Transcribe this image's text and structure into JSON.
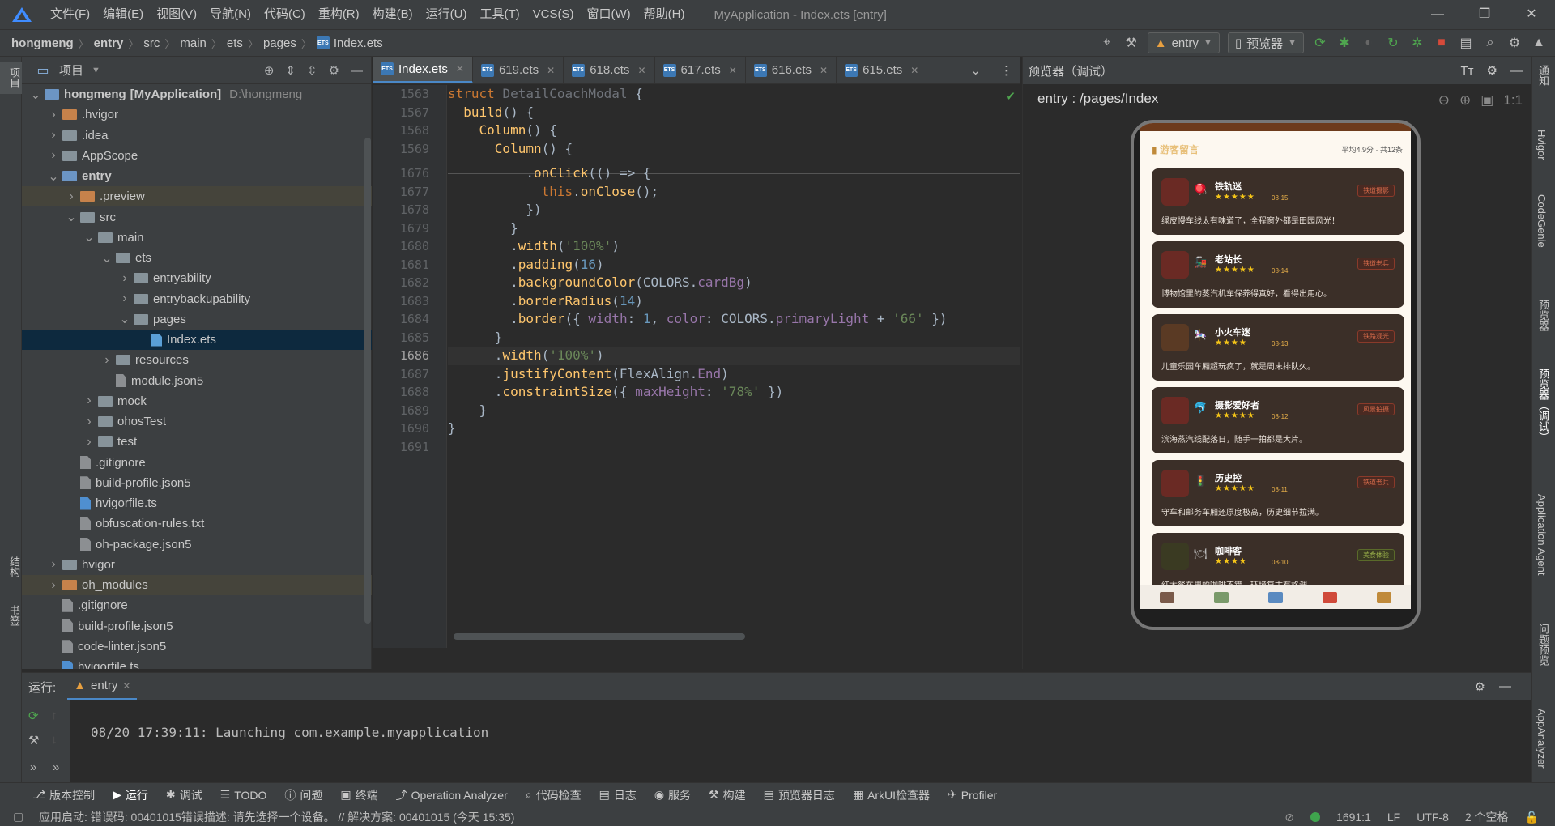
{
  "app": {
    "title": "MyApplication - Index.ets [entry]",
    "menu": [
      "文件(F)",
      "编辑(E)",
      "视图(V)",
      "导航(N)",
      "代码(C)",
      "重构(R)",
      "构建(B)",
      "运行(U)",
      "工具(T)",
      "VCS(S)",
      "窗口(W)",
      "帮助(H)"
    ]
  },
  "breadcrumb": [
    "hongmeng",
    "entry",
    "src",
    "main",
    "ets",
    "pages",
    "Index.ets"
  ],
  "toolbar": {
    "run_config": "entry",
    "device": "预览器"
  },
  "left_strip": {
    "project": "项目",
    "structure": "结构",
    "bookmarks": "书签"
  },
  "project_panel": {
    "title": "项目",
    "tree": [
      {
        "label": "hongmeng",
        "extra": "[MyApplication]",
        "path": "D:\\hongmeng",
        "depth": 0,
        "type": "module",
        "open": true
      },
      {
        "label": ".hvigor",
        "depth": 1,
        "type": "folder-orange",
        "open": false
      },
      {
        "label": ".idea",
        "depth": 1,
        "type": "folder",
        "open": false
      },
      {
        "label": "AppScope",
        "depth": 1,
        "type": "folder",
        "open": false
      },
      {
        "label": "entry",
        "depth": 1,
        "type": "module",
        "open": true,
        "bold": true
      },
      {
        "label": ".preview",
        "depth": 2,
        "type": "folder-orange",
        "open": false,
        "highlight": true
      },
      {
        "label": "src",
        "depth": 2,
        "type": "folder",
        "open": true
      },
      {
        "label": "main",
        "depth": 3,
        "type": "folder",
        "open": true
      },
      {
        "label": "ets",
        "depth": 4,
        "type": "folder",
        "open": true
      },
      {
        "label": "entryability",
        "depth": 5,
        "type": "folder",
        "open": false
      },
      {
        "label": "entrybackupability",
        "depth": 5,
        "type": "folder",
        "open": false
      },
      {
        "label": "pages",
        "depth": 5,
        "type": "folder",
        "open": true
      },
      {
        "label": "Index.ets",
        "depth": 6,
        "type": "file-ets",
        "selected": true
      },
      {
        "label": "resources",
        "depth": 4,
        "type": "folder",
        "open": false
      },
      {
        "label": "module.json5",
        "depth": 4,
        "type": "file"
      },
      {
        "label": "mock",
        "depth": 3,
        "type": "folder",
        "open": false
      },
      {
        "label": "ohosTest",
        "depth": 3,
        "type": "folder",
        "open": false
      },
      {
        "label": "test",
        "depth": 3,
        "type": "folder",
        "open": false
      },
      {
        "label": ".gitignore",
        "depth": 2,
        "type": "file"
      },
      {
        "label": "build-profile.json5",
        "depth": 2,
        "type": "file"
      },
      {
        "label": "hvigorfile.ts",
        "depth": 2,
        "type": "file-ts"
      },
      {
        "label": "obfuscation-rules.txt",
        "depth": 2,
        "type": "file"
      },
      {
        "label": "oh-package.json5",
        "depth": 2,
        "type": "file"
      },
      {
        "label": "hvigor",
        "depth": 1,
        "type": "folder",
        "open": false
      },
      {
        "label": "oh_modules",
        "depth": 1,
        "type": "folder-orange",
        "open": false,
        "highlight": true
      },
      {
        "label": ".gitignore",
        "depth": 1,
        "type": "file"
      },
      {
        "label": "build-profile.json5",
        "depth": 1,
        "type": "file"
      },
      {
        "label": "code-linter.json5",
        "depth": 1,
        "type": "file"
      },
      {
        "label": "hvigorfile.ts",
        "depth": 1,
        "type": "file-ts"
      }
    ]
  },
  "editor": {
    "tabs": [
      "Index.ets",
      "619.ets",
      "618.ets",
      "617.ets",
      "616.ets",
      "615.ets"
    ],
    "active_tab": 0,
    "sticky_lines": [
      {
        "ln": "1563",
        "code": "struct DetailCoachModal {"
      },
      {
        "ln": "1567",
        "code": "  build() {"
      },
      {
        "ln": "1568",
        "code": "    Column() {"
      },
      {
        "ln": "1569",
        "code": "      Column() {"
      }
    ],
    "lines": [
      {
        "ln": "1676",
        "code": "          .onClick(() => {"
      },
      {
        "ln": "1677",
        "code": "            this.onClose();"
      },
      {
        "ln": "1678",
        "code": "          })"
      },
      {
        "ln": "1679",
        "code": "        }"
      },
      {
        "ln": "1680",
        "code": "        .width('100%')"
      },
      {
        "ln": "1681",
        "code": "        .padding(16)"
      },
      {
        "ln": "1682",
        "code": "        .backgroundColor(COLORS.cardBg)"
      },
      {
        "ln": "1683",
        "code": "        .borderRadius(14)"
      },
      {
        "ln": "1684",
        "code": "        .border({ width: 1, color: COLORS.primaryLight + '66' })"
      },
      {
        "ln": "1685",
        "code": "      }"
      },
      {
        "ln": "1686",
        "code": "      .width('100%')"
      },
      {
        "ln": "1687",
        "code": "      .justifyContent(FlexAlign.End)"
      },
      {
        "ln": "1688",
        "code": "      .constraintSize({ maxHeight: '78%' })"
      },
      {
        "ln": "1689",
        "code": "    }"
      },
      {
        "ln": "1690",
        "code": "}"
      },
      {
        "ln": "1691",
        "code": ""
      }
    ],
    "current_line": "1686"
  },
  "preview": {
    "title": "预览器（调试）",
    "route": "entry : /pages/Index",
    "screen": {
      "section_title": "游客留言",
      "meta": "平均4.9分 · 共12条",
      "cards": [
        {
          "name": "铁轨迷",
          "icon": "🪀",
          "stars": "★★★★★",
          "date": "08-15",
          "tag": "铁道摄影",
          "text": "绿皮慢车线太有味道了，全程窗外都是田园风光！"
        },
        {
          "name": "老站长",
          "icon": "🚂",
          "stars": "★★★★★",
          "date": "08-14",
          "tag": "铁道老兵",
          "text": "博物馆里的蒸汽机车保养得真好，看得出用心。"
        },
        {
          "name": "小火车迷",
          "icon": "🎠",
          "stars": "★★★★",
          "date": "08-13",
          "tag": "铁路观光",
          "text": "儿童乐园车厢超玩疯了，就是周末排队久。"
        },
        {
          "name": "摄影爱好者",
          "icon": "🐬",
          "stars": "★★★★★",
          "date": "08-12",
          "tag": "风景拍摄",
          "text": "滨海蒸汽线配落日，随手一拍都是大片。"
        },
        {
          "name": "历史控",
          "icon": "🚦",
          "stars": "★★★★★",
          "date": "08-11",
          "tag": "铁道老兵",
          "text": "守车和邮务车厢还原度极高，历史细节拉满。"
        },
        {
          "name": "咖啡客",
          "icon": "🍽",
          "stars": "★★★★",
          "date": "08-10",
          "tag": "美食体验",
          "text": "红木餐车里的咖啡不错，环境复古有格调。"
        }
      ]
    }
  },
  "right_strip": [
    "通知",
    "Hvigor",
    "CodeGenie",
    "预览器",
    "预览器（调试）",
    "Application Agent",
    "问题预览",
    "AppAnalyzer"
  ],
  "run_panel": {
    "label": "运行:",
    "tab": "entry",
    "log": "08/20 17:39:11: Launching com.example.myapplication"
  },
  "tool_tabs": [
    "版本控制",
    "运行",
    "调试",
    "TODO",
    "问题",
    "终端",
    "Operation Analyzer",
    "代码检查",
    "日志",
    "服务",
    "构建",
    "预览器日志",
    "ArkUI检查器",
    "Profiler"
  ],
  "status": {
    "message": "应用启动: 错误码: 00401015错误描述: 请先选择一个设备。 // 解决方案: 00401015 (今天 15:35)",
    "position": "1691:1",
    "line_sep": "LF",
    "encoding": "UTF-8",
    "indent": "2 个空格"
  },
  "colors": {
    "accent": "#4a88c7",
    "selection": "#0d293e",
    "panel_bg": "#3c3f41",
    "editor_bg": "#2b2b2b"
  }
}
